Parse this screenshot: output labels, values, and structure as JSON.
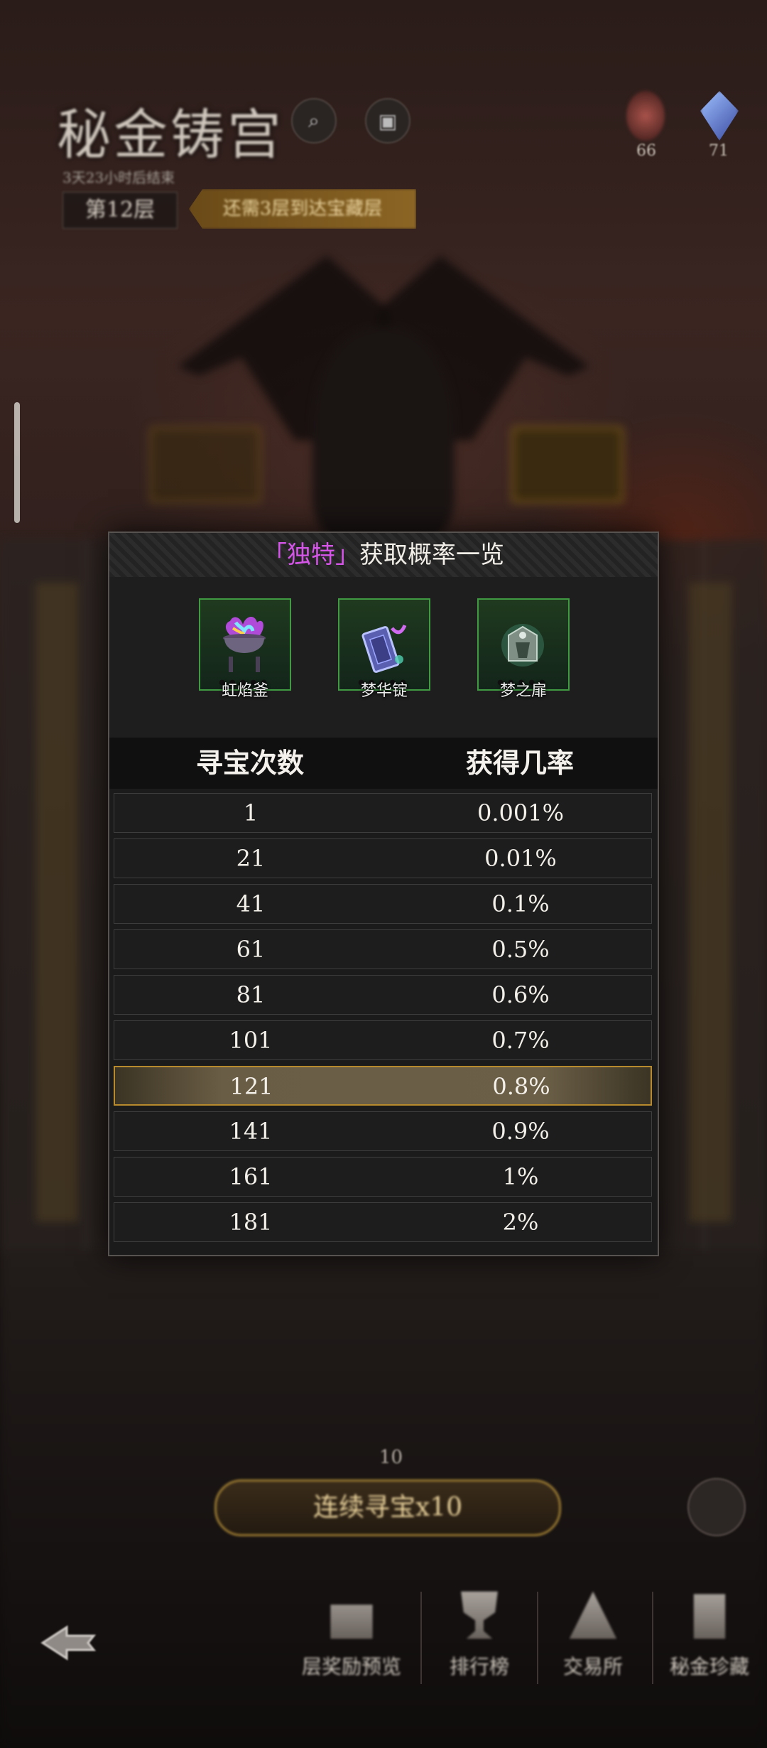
{
  "header": {
    "title": "秘金铸宫",
    "subtitle": "3天23小时后结束",
    "floor": "第12层",
    "floor_hint": "还需3层到达宝藏层",
    "resources": [
      {
        "icon": "red-orb-icon",
        "count": "66"
      },
      {
        "icon": "blue-crystal-icon",
        "count": "71"
      }
    ]
  },
  "modal": {
    "title_bracket_open": "「",
    "title_accent": "独特",
    "title_bracket_close": "」",
    "title_rest": "获取概率一览",
    "accent_color": "#d455e8",
    "items": [
      {
        "label": "虹焰釜",
        "icon": "rainbow-cauldron-icon"
      },
      {
        "label": "梦华锭",
        "icon": "dream-ingot-icon"
      },
      {
        "label": "梦之扉",
        "icon": "dream-door-icon"
      }
    ],
    "columns": [
      "寻宝次数",
      "获得几率"
    ],
    "rows": [
      {
        "count": "1",
        "rate": "0.001%"
      },
      {
        "count": "21",
        "rate": "0.01%"
      },
      {
        "count": "41",
        "rate": "0.1%"
      },
      {
        "count": "61",
        "rate": "0.5%"
      },
      {
        "count": "81",
        "rate": "0.6%"
      },
      {
        "count": "101",
        "rate": "0.7%"
      },
      {
        "count": "121",
        "rate": "0.8%",
        "highlight": true
      },
      {
        "count": "141",
        "rate": "0.9%"
      },
      {
        "count": "161",
        "rate": "1%"
      },
      {
        "count": "181",
        "rate": "2%"
      }
    ]
  },
  "bottom": {
    "count_above": "10",
    "hunt_button": "连续寻宝x10",
    "nav": [
      "层奖励预览",
      "排行榜",
      "交易所",
      "秘金珍藏"
    ]
  }
}
